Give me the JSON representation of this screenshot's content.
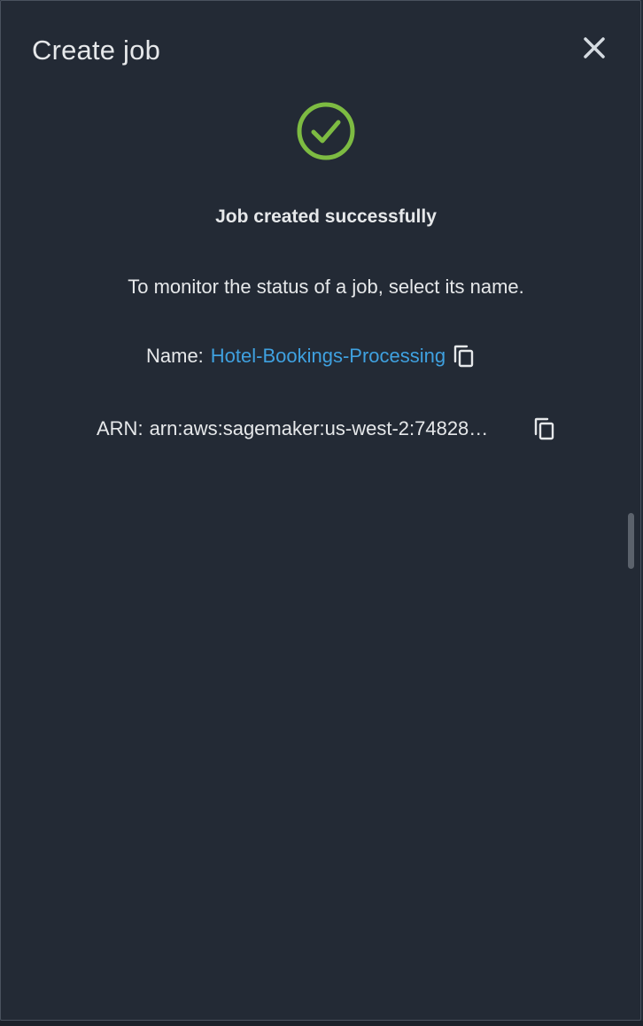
{
  "dialog": {
    "title": "Create job",
    "close_icon": "close-icon"
  },
  "status": {
    "icon": "check-circle-icon",
    "icon_color": "#7dbb42",
    "heading": "Job created successfully",
    "message": "To monitor the status of a job, select its name."
  },
  "job": {
    "name_label": "Name:",
    "name_value": "Hotel-Bookings-Processing",
    "name_color": "#3fa1e0",
    "arn_label": "ARN:",
    "arn_value": "arn:aws:sagemaker:us-west-2:74828…",
    "copy_icon": "copy-icon"
  },
  "colors": {
    "background": "#232a35",
    "text": "#e6e8ea",
    "border": "#4a525e"
  }
}
